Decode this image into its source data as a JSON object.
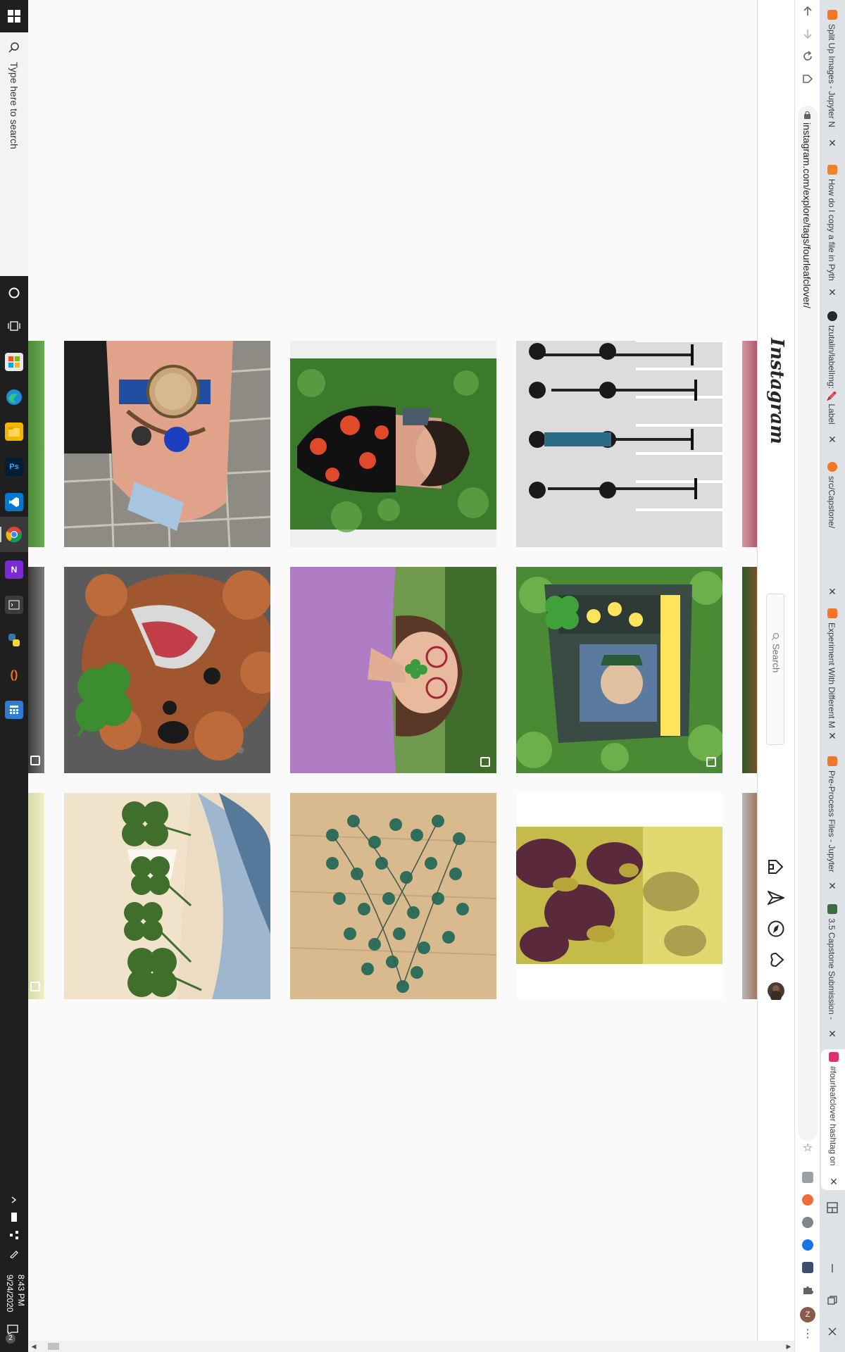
{
  "taskbar": {
    "search_placeholder": "Type here to search",
    "clock_time": "8:43 PM",
    "clock_date": "9/24/2020",
    "notification_count": "2"
  },
  "browser": {
    "tabs": [
      {
        "title": "Split Up Images - Jupyter N",
        "favicon_color": "#f37626"
      },
      {
        "title": "How do I copy a file in Pyth",
        "favicon_color": "#f48024"
      },
      {
        "title": "tzutalin/labelImg: 🖍️ Label",
        "favicon_color": "#24292e"
      },
      {
        "title": "src/Capstone/",
        "favicon_color": "#f37626"
      },
      {
        "title": "Experiment With Different M",
        "favicon_color": "#f37626"
      },
      {
        "title": "Pre-Process Files - Jupyter",
        "favicon_color": "#f37626"
      },
      {
        "title": "3.5 Capstone Submission -",
        "favicon_color": "#3b6e3f"
      },
      {
        "title": "#fourleafclover hashtag on",
        "favicon_color": "#e1306c"
      }
    ],
    "url": "instagram.com/explore/tags/fourleafclover/"
  },
  "instagram": {
    "logo_text": "Instagram",
    "search_placeholder": "Search"
  }
}
